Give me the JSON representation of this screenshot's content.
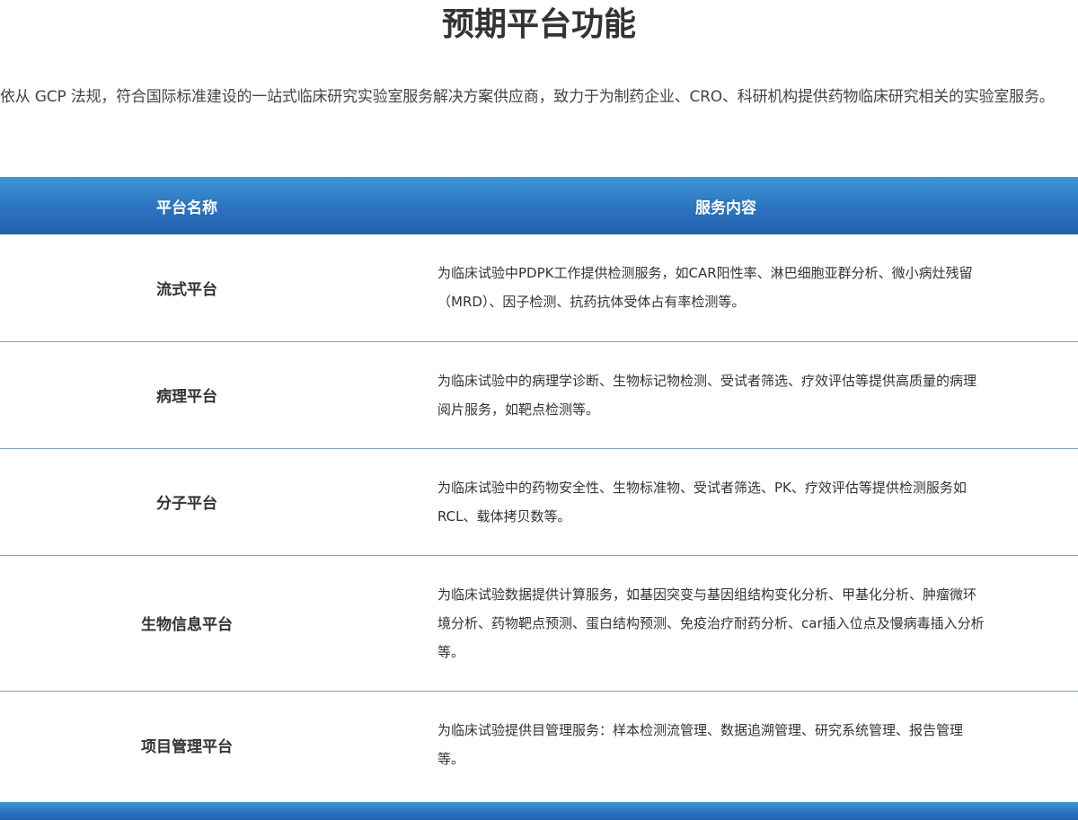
{
  "page": {
    "title": "预期平台功能",
    "intro": "依从 GCP 法规，符合国际标准建设的一站式临床研究实验室服务解决方案供应商，致力于为制药企业、CRO、科研机构提供药物临床研究相关的实验室服务。"
  },
  "table": {
    "headers": {
      "name": "平台名称",
      "content": "服务内容"
    },
    "rows": [
      {
        "name": "流式平台",
        "content": "为临床试验中PDPK工作提供检测服务，如CAR阳性率、淋巴细胞亚群分析、微小病灶残留（MRD）、因子检测、抗药抗体受体占有率检测等。"
      },
      {
        "name": "病理平台",
        "content": "为临床试验中的病理学诊断、生物标记物检测、受试者筛选、疗效评估等提供高质量的病理阅片服务，如靶点检测等。"
      },
      {
        "name": "分子平台",
        "content": "为临床试验中的药物安全性、生物标准物、受试者筛选、PK、疗效评估等提供检测服务如RCL、载体拷贝数等。"
      },
      {
        "name": "生物信息平台",
        "content": "为临床试验数据提供计算服务，如基因突变与基因组结构变化分析、甲基化分析、肿瘤微环境分析、药物靶点预测、蛋白结构预测、免疫治疗耐药分析、car插入位点及慢病毒插入分析等。"
      },
      {
        "name": "项目管理平台",
        "content": "为临床试验提供目管理服务：样本检测流管理、数据追溯管理、研究系统管理、报告管理等。"
      }
    ]
  },
  "colors": {
    "header_blue_top": "#3f95d6",
    "header_blue_bottom": "#2461ae",
    "row_divider": "#6fa8d0",
    "text": "#333333"
  }
}
